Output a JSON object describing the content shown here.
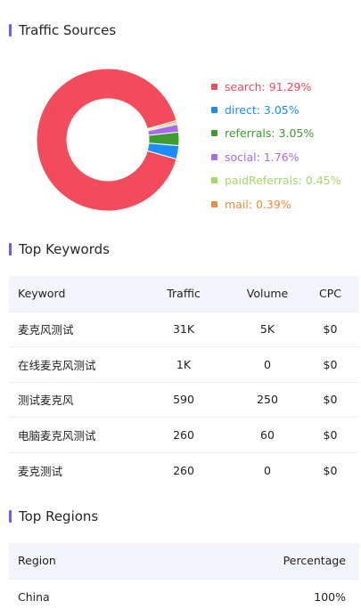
{
  "traffic": {
    "title": "Traffic Sources",
    "sources": [
      {
        "label": "search: 91.29%",
        "value": 91.29,
        "color": "#f24b5b"
      },
      {
        "label": "direct: 3.05%",
        "value": 3.05,
        "color": "#1d8cf8"
      },
      {
        "label": "referrals: 3.05%",
        "value": 3.05,
        "color": "#3c9c2e"
      },
      {
        "label": "social: 1.76%",
        "value": 1.76,
        "color": "#a86ae8"
      },
      {
        "label": "paidReferrals: 0.45%",
        "value": 0.45,
        "color": "#a6d868"
      },
      {
        "label": "mail: 0.39%",
        "value": 0.39,
        "color": "#f08c3c"
      }
    ]
  },
  "chart_data": {
    "type": "pie",
    "categories": [
      "search",
      "direct",
      "referrals",
      "social",
      "paidReferrals",
      "mail"
    ],
    "values": [
      91.29,
      3.05,
      3.05,
      1.76,
      0.45,
      0.39
    ]
  },
  "keywords": {
    "title": "Top Keywords",
    "headers": [
      "Keyword",
      "Traffic",
      "Volume",
      "CPC"
    ],
    "rows": [
      [
        "麦克风测试",
        "31K",
        "5K",
        "$0"
      ],
      [
        "在线麦克风测试",
        "1K",
        "0",
        "$0"
      ],
      [
        "测试麦克风",
        "590",
        "250",
        "$0"
      ],
      [
        "电脑麦克风测试",
        "260",
        "60",
        "$0"
      ],
      [
        "麦克测试",
        "260",
        "0",
        "$0"
      ]
    ]
  },
  "regions": {
    "title": "Top Regions",
    "headers": [
      "Region",
      "Percentage"
    ],
    "rows": [
      [
        "China",
        "100%"
      ]
    ]
  }
}
